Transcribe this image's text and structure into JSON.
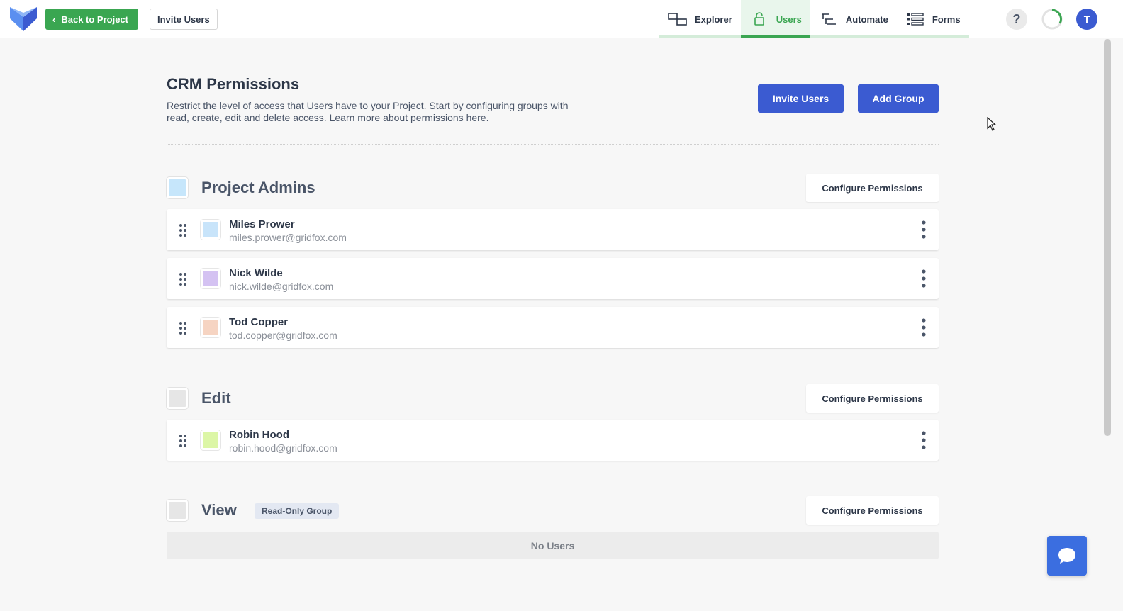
{
  "topbar": {
    "back_label": "Back to Project",
    "invite_label": "Invite Users",
    "nav": [
      {
        "label": "Explorer",
        "icon": "explorer-icon"
      },
      {
        "label": "Users",
        "icon": "lock-icon",
        "active": true
      },
      {
        "label": "Automate",
        "icon": "automate-icon"
      },
      {
        "label": "Forms",
        "icon": "forms-icon"
      }
    ],
    "help_label": "?",
    "avatar_initial": "T"
  },
  "header": {
    "title": "CRM Permissions",
    "description": "Restrict the level of access that Users have to your Project. Start by configuring groups with read, create, edit and delete access. Learn more about permissions here.",
    "invite_label": "Invite Users",
    "add_group_label": "Add Group"
  },
  "groups": [
    {
      "name": "Project Admins",
      "color": "#c6e6fb",
      "configure_label": "Configure Permissions",
      "users": [
        {
          "name": "Miles Prower",
          "email": "miles.prower@gridfox.com",
          "color": "#c8e4fa"
        },
        {
          "name": "Nick Wilde",
          "email": "nick.wilde@gridfox.com",
          "color": "#d4c2f2"
        },
        {
          "name": "Tod Copper",
          "email": "tod.copper@gridfox.com",
          "color": "#f6d4c2"
        }
      ]
    },
    {
      "name": "Edit",
      "color": "#e6e6e6",
      "configure_label": "Configure Permissions",
      "users": [
        {
          "name": "Robin Hood",
          "email": "robin.hood@gridfox.com",
          "color": "#dcf6a6"
        }
      ]
    },
    {
      "name": "View",
      "color": "#e6e6e6",
      "badge": "Read-Only Group",
      "configure_label": "Configure Permissions",
      "empty_label": "No Users"
    }
  ],
  "colors": {
    "brand_green": "#3aa651",
    "primary_blue": "#3b5bd1",
    "chat_blue": "#3b6ee0"
  }
}
